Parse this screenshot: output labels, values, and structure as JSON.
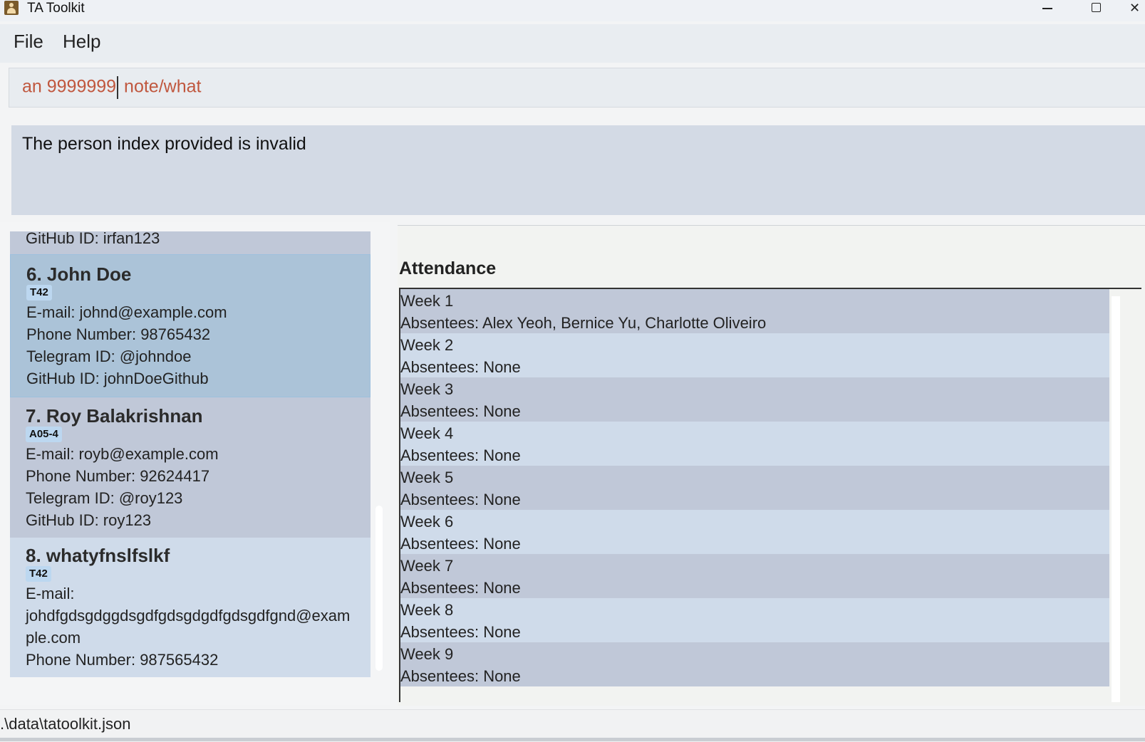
{
  "window": {
    "title": "TA Toolkit",
    "close_glyph": "✕"
  },
  "menu": {
    "file": "File",
    "help": "Help"
  },
  "command": {
    "before_caret": "an 9999999",
    "after_caret": " note/what"
  },
  "result": {
    "message": "The person index provided is invalid"
  },
  "persons": {
    "partial": {
      "github": "GitHub ID: irfan123"
    },
    "p6": {
      "name": "6.  John Doe",
      "tag": "T42",
      "email": "E-mail: johnd@example.com",
      "phone": "Phone Number: 98765432",
      "telegram": "Telegram ID: @johndoe",
      "github": "GitHub ID: johnDoeGithub"
    },
    "p7": {
      "name": "7.  Roy Balakrishnan",
      "tag": "A05-4",
      "email": "E-mail: royb@example.com",
      "phone": "Phone Number: 92624417",
      "telegram": "Telegram ID: @roy123",
      "github": "GitHub ID: roy123"
    },
    "p8": {
      "name": "8.  whatyfnslfslkf",
      "tag": "T42",
      "email_label": "E-mail:",
      "email_line1": "johdfgdsgdggdsgdfgdsgdgdfgdsgdfgnd@exam",
      "email_line2": "ple.com",
      "phone": "Phone Number: 987565432"
    }
  },
  "attendance": {
    "title": "Attendance",
    "weeks": [
      {
        "week": "Week 1",
        "absentees": "Absentees: Alex Yeoh, Bernice Yu, Charlotte Oliveiro"
      },
      {
        "week": "Week 2",
        "absentees": "Absentees: None"
      },
      {
        "week": "Week 3",
        "absentees": "Absentees: None"
      },
      {
        "week": "Week 4",
        "absentees": "Absentees: None"
      },
      {
        "week": "Week 5",
        "absentees": "Absentees: None"
      },
      {
        "week": "Week 6",
        "absentees": "Absentees: None"
      },
      {
        "week": "Week 7",
        "absentees": "Absentees: None"
      },
      {
        "week": "Week 8",
        "absentees": "Absentees: None"
      },
      {
        "week": "Week 9",
        "absentees": "Absentees: None"
      }
    ]
  },
  "status": {
    "path": ".\\data\\tatoolkit.json"
  }
}
